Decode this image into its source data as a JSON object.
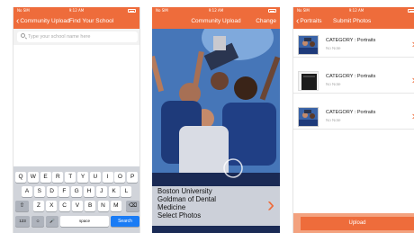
{
  "status_bar": {
    "carrier": "No SIM",
    "time": "9:12 AM"
  },
  "screen1": {
    "nav": {
      "back_label": "Community Upload",
      "title": "Find Your School"
    },
    "search": {
      "placeholder": "Type your school name here",
      "value": ""
    },
    "keyboard": {
      "row1": [
        "Q",
        "W",
        "E",
        "R",
        "T",
        "Y",
        "U",
        "I",
        "O",
        "P"
      ],
      "row2": [
        "A",
        "S",
        "D",
        "F",
        "G",
        "H",
        "J",
        "K",
        "L"
      ],
      "row3": [
        "Z",
        "X",
        "C",
        "V",
        "B",
        "N",
        "M"
      ],
      "shift": "⇧",
      "delete": "⌫",
      "numbers": "123",
      "emoji": "☺",
      "mic": "🎤",
      "space": "space",
      "search": "Search"
    }
  },
  "screen2": {
    "nav": {
      "title": "Community Upload",
      "right": "Change"
    },
    "overlay": {
      "line1": "Boston University",
      "line2": "Goldman of Dental",
      "line3": "Medicine",
      "line4": "Select Photos"
    },
    "arrow": "›"
  },
  "screen3": {
    "nav": {
      "back_label": "Portraits",
      "title": "Submit Photos"
    },
    "items": [
      {
        "category": "CATEGORY : Portraits",
        "note": "No Note"
      },
      {
        "category": "CATEGORY : Portraits",
        "note": "No Note"
      },
      {
        "category": "CATEGORY : Portraits",
        "note": "No Note"
      }
    ],
    "upload_label": "Upload"
  },
  "colors": {
    "accent": "#ee6c3b",
    "keyboard_bg": "#d1d4da",
    "key_blue": "#1a7cf5"
  }
}
